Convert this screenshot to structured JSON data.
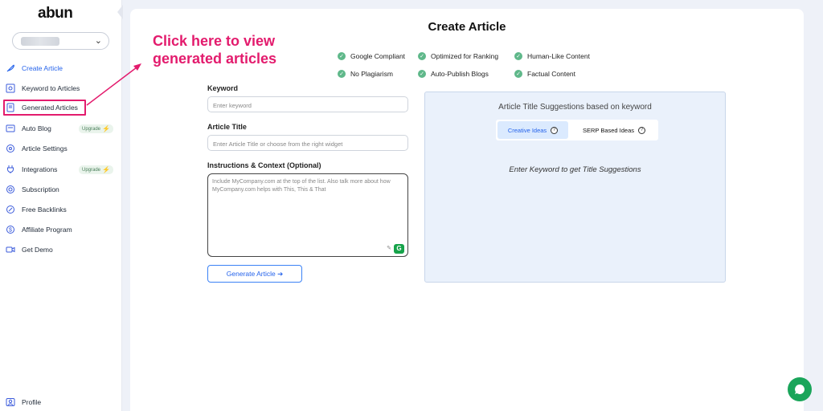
{
  "app": {
    "logo": "abun",
    "workspace_selector": ""
  },
  "sidebar": {
    "items": [
      {
        "label": "Create Article",
        "icon": "feather-icon"
      },
      {
        "label": "Keyword to Articles",
        "icon": "keyword-search-icon"
      },
      {
        "label": "Generated Articles",
        "icon": "document-icon"
      },
      {
        "label": "Auto Blog",
        "icon": "blog-icon",
        "badge": "Upgrade"
      },
      {
        "label": "Article Settings",
        "icon": "settings-icon"
      },
      {
        "label": "Integrations",
        "icon": "plug-icon",
        "badge": "Upgrade"
      },
      {
        "label": "Subscription",
        "icon": "subscription-icon"
      },
      {
        "label": "Free Backlinks",
        "icon": "link-icon"
      },
      {
        "label": "Affiliate Program",
        "icon": "dollar-icon"
      },
      {
        "label": "Get Demo",
        "icon": "video-icon"
      }
    ],
    "profile_label": "Profile"
  },
  "main": {
    "title": "Create Article",
    "features": [
      "Google Compliant",
      "Optimized for Ranking",
      "Human-Like Content",
      "No Plagiarism",
      "Auto-Publish Blogs",
      "Factual Content"
    ],
    "keyword": {
      "label": "Keyword",
      "placeholder": "Enter keyword"
    },
    "article_title": {
      "label": "Article Title",
      "placeholder": "Enter Article Title or choose from the right widget"
    },
    "instructions": {
      "label": "Instructions & Context (Optional)",
      "placeholder": "Include MyCompany.com at the top of the list. Also talk more about how MyCompany.com helps with This, This & That"
    },
    "generate_button": "Generate Article ➔"
  },
  "suggestions": {
    "title": "Article Title Suggestions based on keyword",
    "tabs": [
      "Creative Ideas",
      "SERP Based Ideas"
    ],
    "active_tab": "Creative Ideas",
    "help_glyph": "?",
    "empty_message": "Enter Keyword to get Title Suggestions"
  },
  "annotation": {
    "line1": "Click here to view",
    "line2": "generated articles"
  },
  "colors": {
    "accent": "#2563eb",
    "annotation": "#e31b6d",
    "check": "#5fb88a",
    "chat": "#1aa55a"
  }
}
